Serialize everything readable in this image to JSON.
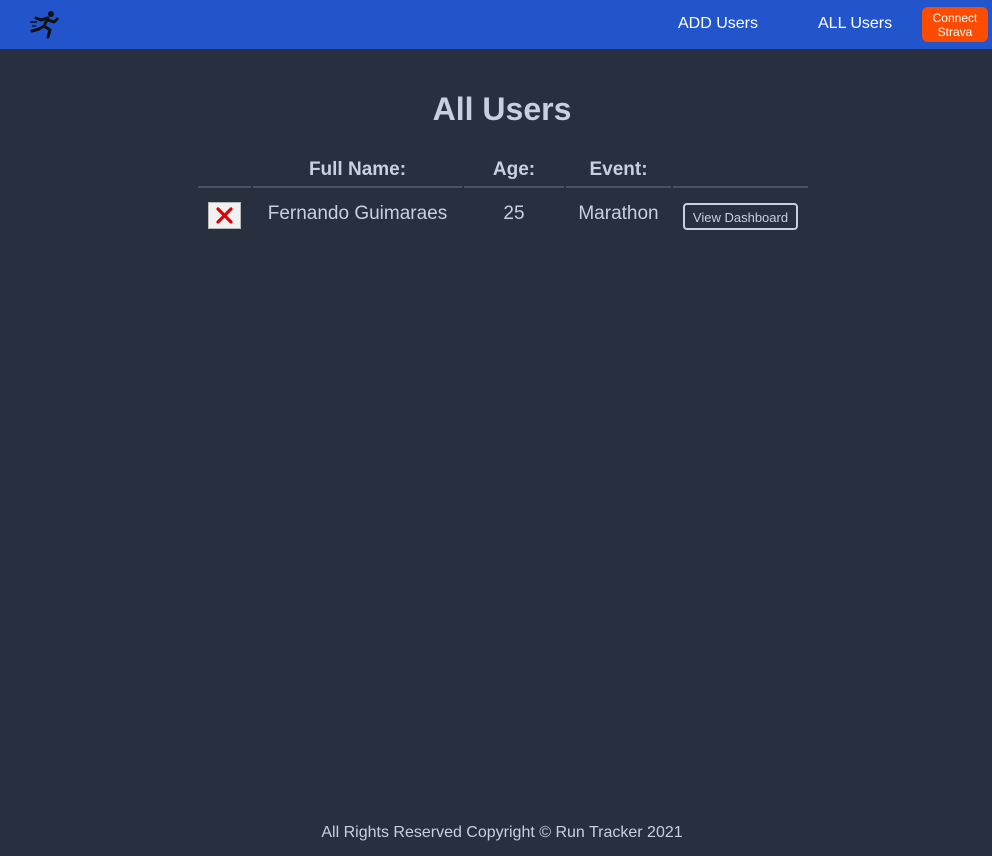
{
  "nav": {
    "logo_icon": "runner-icon",
    "links": [
      {
        "label": "ADD Users"
      },
      {
        "label": "ALL Users"
      }
    ],
    "strava_button": {
      "label_line1": "Connect",
      "label_line2": "Strava",
      "color": "#fc4c02"
    },
    "bar_color": "#2255cc"
  },
  "main": {
    "title": "All Users",
    "table": {
      "headers": [
        "",
        "Full Name:",
        "Age:",
        "Event:",
        ""
      ],
      "rows": [
        {
          "delete_icon": "close-icon",
          "full_name": "Fernando Guimaraes",
          "age": "25",
          "event": "Marathon",
          "action_label": "View Dashboard"
        }
      ]
    }
  },
  "footer": {
    "text": "All Rights Reserved Copyright © Run Tracker 2021"
  },
  "colors": {
    "background": "#282f3e",
    "text": "#c8d0e0",
    "delete_x": "#e00000"
  }
}
